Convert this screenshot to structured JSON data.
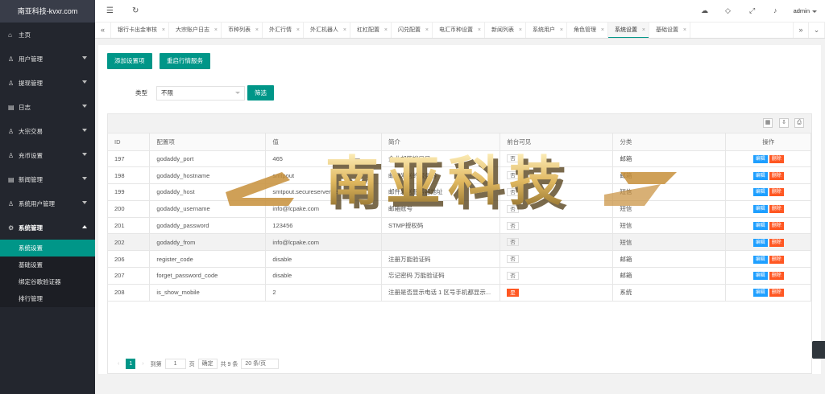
{
  "app": {
    "logo": "南亚科技-kvxr.com",
    "user": "admin"
  },
  "sidebar": {
    "items": [
      {
        "label": "主页",
        "icon": "home-icon",
        "caret": false
      },
      {
        "label": "用户管理",
        "icon": "user-icon",
        "caret": true
      },
      {
        "label": "提现管理",
        "icon": "user-icon",
        "caret": true
      },
      {
        "label": "日志",
        "icon": "file-icon",
        "caret": true
      },
      {
        "label": "大宗交易",
        "icon": "user-icon",
        "caret": true
      },
      {
        "label": "充币设置",
        "icon": "user-icon",
        "caret": true
      },
      {
        "label": "新闻管理",
        "icon": "file-icon",
        "caret": true
      },
      {
        "label": "系统用户管理",
        "icon": "user-icon",
        "caret": true
      },
      {
        "label": "系统管理",
        "icon": "gear-icon",
        "caret": true,
        "open": true
      }
    ],
    "sub": [
      "系统设置",
      "基础设置",
      "绑定谷歌验证器",
      "排行管理"
    ]
  },
  "tabs": [
    "银行卡出金审核",
    "大宗账户日志",
    "币种列表",
    "外汇行情",
    "外汇机器人",
    "杠杠配置",
    "闪兑配置",
    "电汇币种设置",
    "新闻列表",
    "系统用户",
    "角色管理",
    "系统设置",
    "基础设置"
  ],
  "toolbar": {
    "add": "添加设置项",
    "restart": "重启行情服务"
  },
  "filter": {
    "label": "类型",
    "value": "不限",
    "button": "筛选"
  },
  "table": {
    "headers": [
      "ID",
      "配置项",
      "值",
      "简介",
      "前台可见",
      "分类",
      "操作"
    ],
    "rows": [
      [
        "197",
        "godaddy_port",
        "465",
        "企业邮箱端口号",
        "否",
        "邮箱"
      ],
      [
        "198",
        "godaddy_hostname",
        "smtpout",
        "邮箱发送的服务器",
        "否",
        "邮箱"
      ],
      [
        "199",
        "godaddy_host",
        "smtpout.secureserver.net",
        "邮件发送服务器地址",
        "否",
        "短信"
      ],
      [
        "200",
        "godaddy_username",
        "info@lcpake.com",
        "邮箱账号",
        "否",
        "短信"
      ],
      [
        "201",
        "godaddy_password",
        "123456",
        "STMP授权码",
        "否",
        "短信"
      ],
      [
        "202",
        "godaddy_from",
        "info@lcpake.com",
        "",
        "否",
        "短信"
      ],
      [
        "206",
        "register_code",
        "disable",
        "注册万能验证码",
        "否",
        "邮箱"
      ],
      [
        "207",
        "forget_password_code",
        "disable",
        "忘记密码 万能验证码",
        "否",
        "邮箱"
      ],
      [
        "208",
        "is_show_mobile",
        "2",
        "注册是否显示电话 1 区号手机都显示...",
        "是",
        "系统"
      ]
    ],
    "edit": "编辑",
    "delete": "删除"
  },
  "pager": {
    "prev": "‹",
    "page": "1",
    "next": "›",
    "goto": "到第",
    "input": "1",
    "unit": "页",
    "confirm": "确定",
    "total": "共 9 条",
    "per": "20 条/页"
  },
  "watermark": "南亚科技"
}
